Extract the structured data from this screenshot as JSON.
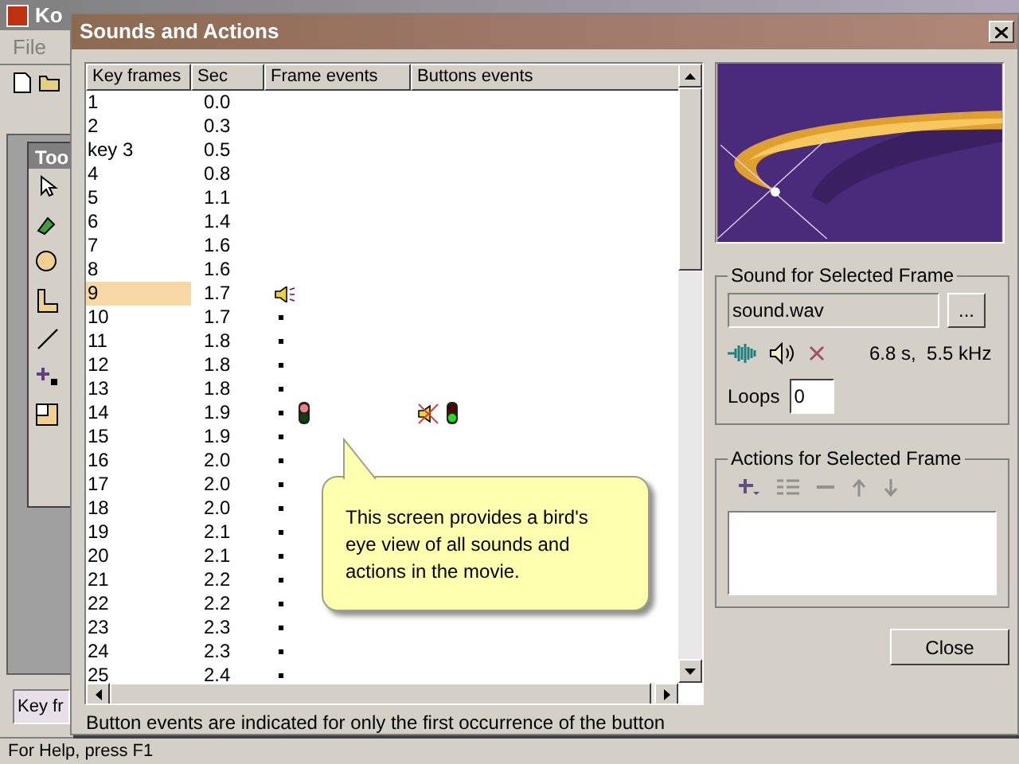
{
  "app": {
    "title": "Ko",
    "menu": [
      "File"
    ],
    "toolbox_title": "Too",
    "field_value": "Key fr",
    "status_bar": "For Help, press F1"
  },
  "dialog": {
    "title": "Sounds and Actions",
    "table": {
      "columns": [
        "Key frames",
        "Sec",
        "Frame events",
        "Buttons events"
      ],
      "rows": [
        {
          "frame": "1",
          "sec": "0.0",
          "selected": false,
          "frame_events": [],
          "button_events": []
        },
        {
          "frame": "2",
          "sec": "0.3",
          "selected": false,
          "frame_events": [],
          "button_events": []
        },
        {
          "frame": "key 3",
          "sec": "0.5",
          "selected": false,
          "frame_events": [],
          "button_events": []
        },
        {
          "frame": "4",
          "sec": "0.8",
          "selected": false,
          "frame_events": [],
          "button_events": []
        },
        {
          "frame": "5",
          "sec": "1.1",
          "selected": false,
          "frame_events": [],
          "button_events": []
        },
        {
          "frame": "6",
          "sec": "1.4",
          "selected": false,
          "frame_events": [],
          "button_events": []
        },
        {
          "frame": "7",
          "sec": "1.6",
          "selected": false,
          "frame_events": [],
          "button_events": []
        },
        {
          "frame": "8",
          "sec": "1.6",
          "selected": false,
          "frame_events": [],
          "button_events": []
        },
        {
          "frame": "9",
          "sec": "1.7",
          "selected": true,
          "frame_events": [
            {
              "kind": "sound"
            }
          ],
          "button_events": []
        },
        {
          "frame": "10",
          "sec": "1.7",
          "selected": false,
          "frame_events": [
            {
              "kind": "dot"
            }
          ],
          "button_events": []
        },
        {
          "frame": "11",
          "sec": "1.8",
          "selected": false,
          "frame_events": [
            {
              "kind": "dot"
            }
          ],
          "button_events": []
        },
        {
          "frame": "12",
          "sec": "1.8",
          "selected": false,
          "frame_events": [
            {
              "kind": "dot"
            }
          ],
          "button_events": []
        },
        {
          "frame": "13",
          "sec": "1.8",
          "selected": false,
          "frame_events": [
            {
              "kind": "dot"
            }
          ],
          "button_events": []
        },
        {
          "frame": "14",
          "sec": "1.9",
          "selected": false,
          "frame_events": [
            {
              "kind": "dot"
            },
            {
              "kind": "stop_light"
            }
          ],
          "button_events": [
            {
              "kind": "muted_sound"
            },
            {
              "kind": "go_light"
            }
          ]
        },
        {
          "frame": "15",
          "sec": "1.9",
          "selected": false,
          "frame_events": [
            {
              "kind": "dot"
            }
          ],
          "button_events": []
        },
        {
          "frame": "16",
          "sec": "2.0",
          "selected": false,
          "frame_events": [
            {
              "kind": "dot"
            }
          ],
          "button_events": []
        },
        {
          "frame": "17",
          "sec": "2.0",
          "selected": false,
          "frame_events": [
            {
              "kind": "dot"
            }
          ],
          "button_events": []
        },
        {
          "frame": "18",
          "sec": "2.0",
          "selected": false,
          "frame_events": [
            {
              "kind": "dot"
            }
          ],
          "button_events": []
        },
        {
          "frame": "19",
          "sec": "2.1",
          "selected": false,
          "frame_events": [
            {
              "kind": "dot"
            }
          ],
          "button_events": []
        },
        {
          "frame": "20",
          "sec": "2.1",
          "selected": false,
          "frame_events": [
            {
              "kind": "dot"
            }
          ],
          "button_events": []
        },
        {
          "frame": "21",
          "sec": "2.2",
          "selected": false,
          "frame_events": [
            {
              "kind": "dot"
            }
          ],
          "button_events": []
        },
        {
          "frame": "22",
          "sec": "2.2",
          "selected": false,
          "frame_events": [
            {
              "kind": "dot"
            }
          ],
          "button_events": []
        },
        {
          "frame": "23",
          "sec": "2.3",
          "selected": false,
          "frame_events": [
            {
              "kind": "dot"
            }
          ],
          "button_events": []
        },
        {
          "frame": "24",
          "sec": "2.3",
          "selected": false,
          "frame_events": [
            {
              "kind": "dot"
            }
          ],
          "button_events": []
        },
        {
          "frame": "25",
          "sec": "2.4",
          "selected": false,
          "frame_events": [
            {
              "kind": "dot"
            }
          ],
          "button_events": []
        }
      ]
    },
    "tooltip": "This screen provides a bird's eye view of all sounds and actions in the movie.",
    "note": "Button events are indicated for only the first occurrence of the button",
    "sound": {
      "title": "Sound for Selected Frame",
      "file": "sound.wav",
      "browse": "...",
      "info": "6.8 s,  5.5 kHz",
      "loops_label": "Loops",
      "loops": "0"
    },
    "actions": {
      "title": "Actions for Selected Frame"
    },
    "close": "Close"
  }
}
